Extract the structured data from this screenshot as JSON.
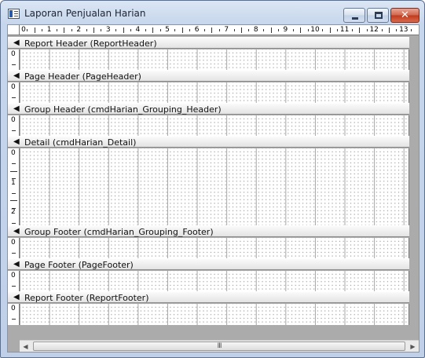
{
  "window": {
    "title": "Laporan Penjualan Harian",
    "icon": "report-icon",
    "controls": {
      "minimize": "minimize-icon",
      "maximize": "maximize-icon",
      "close_glyph": "✕"
    }
  },
  "ruler": {
    "numbers": [
      "0",
      "1",
      "2",
      "3",
      "4",
      "5",
      "6",
      "7",
      "8",
      "9",
      "10",
      "11",
      "12",
      "13"
    ]
  },
  "sections": [
    {
      "label": "Report Header (ReportHeader)",
      "vruler": [
        "0"
      ]
    },
    {
      "label": "Page Header (PageHeader)",
      "vruler": [
        "0"
      ]
    },
    {
      "label": "Group Header (cmdHarian_Grouping_Header)",
      "vruler": [
        "0"
      ]
    },
    {
      "label": "Detail (cmdHarian_Detail)",
      "vruler": [
        "0",
        "1",
        "2"
      ]
    },
    {
      "label": "Group Footer (cmdHarian_Grouping_Footer)",
      "vruler": [
        "0"
      ]
    },
    {
      "label": "Page Footer (PageFooter)",
      "vruler": [
        "0"
      ]
    },
    {
      "label": "Report Footer (ReportFooter)",
      "vruler": [
        "0"
      ]
    }
  ],
  "scrollbar": {
    "grip": "III",
    "left_arrow": "◀",
    "right_arrow": "▶"
  },
  "colors": {
    "titlebar": "#c6d6ec",
    "close_button": "#c0391c",
    "design_surface": "#ffffff",
    "workspace": "#ababab"
  }
}
